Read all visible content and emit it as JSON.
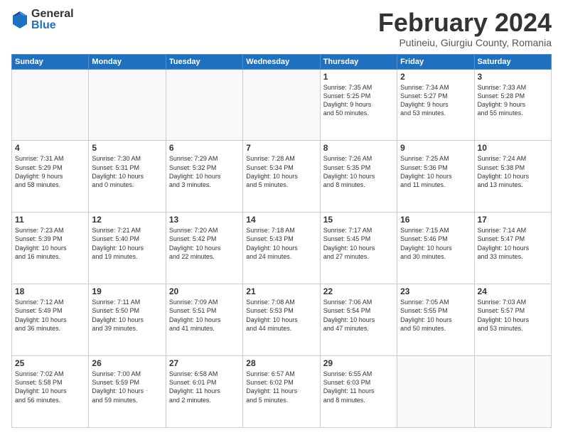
{
  "logo": {
    "general": "General",
    "blue": "Blue"
  },
  "header": {
    "month": "February 2024",
    "location": "Putineiu, Giurgiu County, Romania"
  },
  "weekdays": [
    "Sunday",
    "Monday",
    "Tuesday",
    "Wednesday",
    "Thursday",
    "Friday",
    "Saturday"
  ],
  "weeks": [
    [
      {
        "day": "",
        "info": ""
      },
      {
        "day": "",
        "info": ""
      },
      {
        "day": "",
        "info": ""
      },
      {
        "day": "",
        "info": ""
      },
      {
        "day": "1",
        "info": "Sunrise: 7:35 AM\nSunset: 5:25 PM\nDaylight: 9 hours\nand 50 minutes."
      },
      {
        "day": "2",
        "info": "Sunrise: 7:34 AM\nSunset: 5:27 PM\nDaylight: 9 hours\nand 53 minutes."
      },
      {
        "day": "3",
        "info": "Sunrise: 7:33 AM\nSunset: 5:28 PM\nDaylight: 9 hours\nand 55 minutes."
      }
    ],
    [
      {
        "day": "4",
        "info": "Sunrise: 7:31 AM\nSunset: 5:29 PM\nDaylight: 9 hours\nand 58 minutes."
      },
      {
        "day": "5",
        "info": "Sunrise: 7:30 AM\nSunset: 5:31 PM\nDaylight: 10 hours\nand 0 minutes."
      },
      {
        "day": "6",
        "info": "Sunrise: 7:29 AM\nSunset: 5:32 PM\nDaylight: 10 hours\nand 3 minutes."
      },
      {
        "day": "7",
        "info": "Sunrise: 7:28 AM\nSunset: 5:34 PM\nDaylight: 10 hours\nand 5 minutes."
      },
      {
        "day": "8",
        "info": "Sunrise: 7:26 AM\nSunset: 5:35 PM\nDaylight: 10 hours\nand 8 minutes."
      },
      {
        "day": "9",
        "info": "Sunrise: 7:25 AM\nSunset: 5:36 PM\nDaylight: 10 hours\nand 11 minutes."
      },
      {
        "day": "10",
        "info": "Sunrise: 7:24 AM\nSunset: 5:38 PM\nDaylight: 10 hours\nand 13 minutes."
      }
    ],
    [
      {
        "day": "11",
        "info": "Sunrise: 7:23 AM\nSunset: 5:39 PM\nDaylight: 10 hours\nand 16 minutes."
      },
      {
        "day": "12",
        "info": "Sunrise: 7:21 AM\nSunset: 5:40 PM\nDaylight: 10 hours\nand 19 minutes."
      },
      {
        "day": "13",
        "info": "Sunrise: 7:20 AM\nSunset: 5:42 PM\nDaylight: 10 hours\nand 22 minutes."
      },
      {
        "day": "14",
        "info": "Sunrise: 7:18 AM\nSunset: 5:43 PM\nDaylight: 10 hours\nand 24 minutes."
      },
      {
        "day": "15",
        "info": "Sunrise: 7:17 AM\nSunset: 5:45 PM\nDaylight: 10 hours\nand 27 minutes."
      },
      {
        "day": "16",
        "info": "Sunrise: 7:15 AM\nSunset: 5:46 PM\nDaylight: 10 hours\nand 30 minutes."
      },
      {
        "day": "17",
        "info": "Sunrise: 7:14 AM\nSunset: 5:47 PM\nDaylight: 10 hours\nand 33 minutes."
      }
    ],
    [
      {
        "day": "18",
        "info": "Sunrise: 7:12 AM\nSunset: 5:49 PM\nDaylight: 10 hours\nand 36 minutes."
      },
      {
        "day": "19",
        "info": "Sunrise: 7:11 AM\nSunset: 5:50 PM\nDaylight: 10 hours\nand 39 minutes."
      },
      {
        "day": "20",
        "info": "Sunrise: 7:09 AM\nSunset: 5:51 PM\nDaylight: 10 hours\nand 41 minutes."
      },
      {
        "day": "21",
        "info": "Sunrise: 7:08 AM\nSunset: 5:53 PM\nDaylight: 10 hours\nand 44 minutes."
      },
      {
        "day": "22",
        "info": "Sunrise: 7:06 AM\nSunset: 5:54 PM\nDaylight: 10 hours\nand 47 minutes."
      },
      {
        "day": "23",
        "info": "Sunrise: 7:05 AM\nSunset: 5:55 PM\nDaylight: 10 hours\nand 50 minutes."
      },
      {
        "day": "24",
        "info": "Sunrise: 7:03 AM\nSunset: 5:57 PM\nDaylight: 10 hours\nand 53 minutes."
      }
    ],
    [
      {
        "day": "25",
        "info": "Sunrise: 7:02 AM\nSunset: 5:58 PM\nDaylight: 10 hours\nand 56 minutes."
      },
      {
        "day": "26",
        "info": "Sunrise: 7:00 AM\nSunset: 5:59 PM\nDaylight: 10 hours\nand 59 minutes."
      },
      {
        "day": "27",
        "info": "Sunrise: 6:58 AM\nSunset: 6:01 PM\nDaylight: 11 hours\nand 2 minutes."
      },
      {
        "day": "28",
        "info": "Sunrise: 6:57 AM\nSunset: 6:02 PM\nDaylight: 11 hours\nand 5 minutes."
      },
      {
        "day": "29",
        "info": "Sunrise: 6:55 AM\nSunset: 6:03 PM\nDaylight: 11 hours\nand 8 minutes."
      },
      {
        "day": "",
        "info": ""
      },
      {
        "day": "",
        "info": ""
      }
    ]
  ]
}
